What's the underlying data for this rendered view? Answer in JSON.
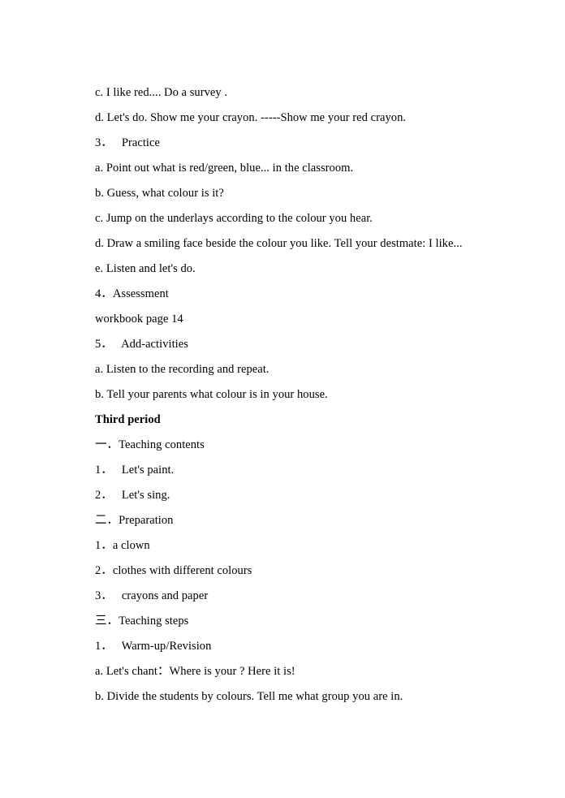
{
  "document": {
    "type": "lesson-plan",
    "page_background": "#ffffff",
    "text_color": "#000000",
    "lines": [
      {
        "id": "l01",
        "text": "c. I like red.... Do a survey .",
        "style": "normal"
      },
      {
        "id": "l02",
        "text": "d. Let's do. Show me your crayon. -----Show me your red crayon.",
        "style": "normal"
      },
      {
        "id": "l03",
        "text": "3．   Practice",
        "style": "normal"
      },
      {
        "id": "l04",
        "text": "a. Point out what is red/green, blue... in the classroom.",
        "style": "normal"
      },
      {
        "id": "l05",
        "text": "b. Guess, what colour is it?",
        "style": "normal"
      },
      {
        "id": "l06",
        "text": "c. Jump on the underlays according to the colour you hear.",
        "style": "normal"
      },
      {
        "id": "l07",
        "text": "d. Draw a smiling face beside the colour you like. Tell your destmate: I like...",
        "style": "normal"
      },
      {
        "id": "l08",
        "text": "e. Listen and let's do.",
        "style": "normal"
      },
      {
        "id": "l09",
        "text": "4．Assessment",
        "style": "normal"
      },
      {
        "id": "l10",
        "text": "workbook page 14",
        "style": "normal"
      },
      {
        "id": "l11",
        "text": "5．   Add-activities",
        "style": "normal"
      },
      {
        "id": "l12",
        "text": "a. Listen to the recording and repeat.",
        "style": "normal"
      },
      {
        "id": "l13",
        "text": "b. Tell your parents what colour is in your house.",
        "style": "normal"
      },
      {
        "id": "l14",
        "text": "Third period",
        "style": "bold"
      },
      {
        "id": "l15",
        "text": "一．Teaching contents",
        "style": "section"
      },
      {
        "id": "l16",
        "text": "1．   Let's paint.",
        "style": "normal"
      },
      {
        "id": "l17",
        "text": "2．   Let's sing.",
        "style": "normal"
      },
      {
        "id": "l18",
        "text": "二．Preparation",
        "style": "section"
      },
      {
        "id": "l19",
        "text": "1．a clown",
        "style": "normal"
      },
      {
        "id": "l20",
        "text": "2．clothes with different colours",
        "style": "normal"
      },
      {
        "id": "l21",
        "text": "3．   crayons and paper",
        "style": "normal"
      },
      {
        "id": "l22",
        "text": "三．Teaching steps",
        "style": "section"
      },
      {
        "id": "l23",
        "text": "1．   Warm-up/Revision",
        "style": "normal"
      },
      {
        "id": "l24",
        "text": "a. Let's chant：Where is your ? Here it is!",
        "style": "normal"
      },
      {
        "id": "l25",
        "text": "b. Divide the students by colours. Tell me what group you are in.",
        "style": "normal"
      }
    ]
  }
}
